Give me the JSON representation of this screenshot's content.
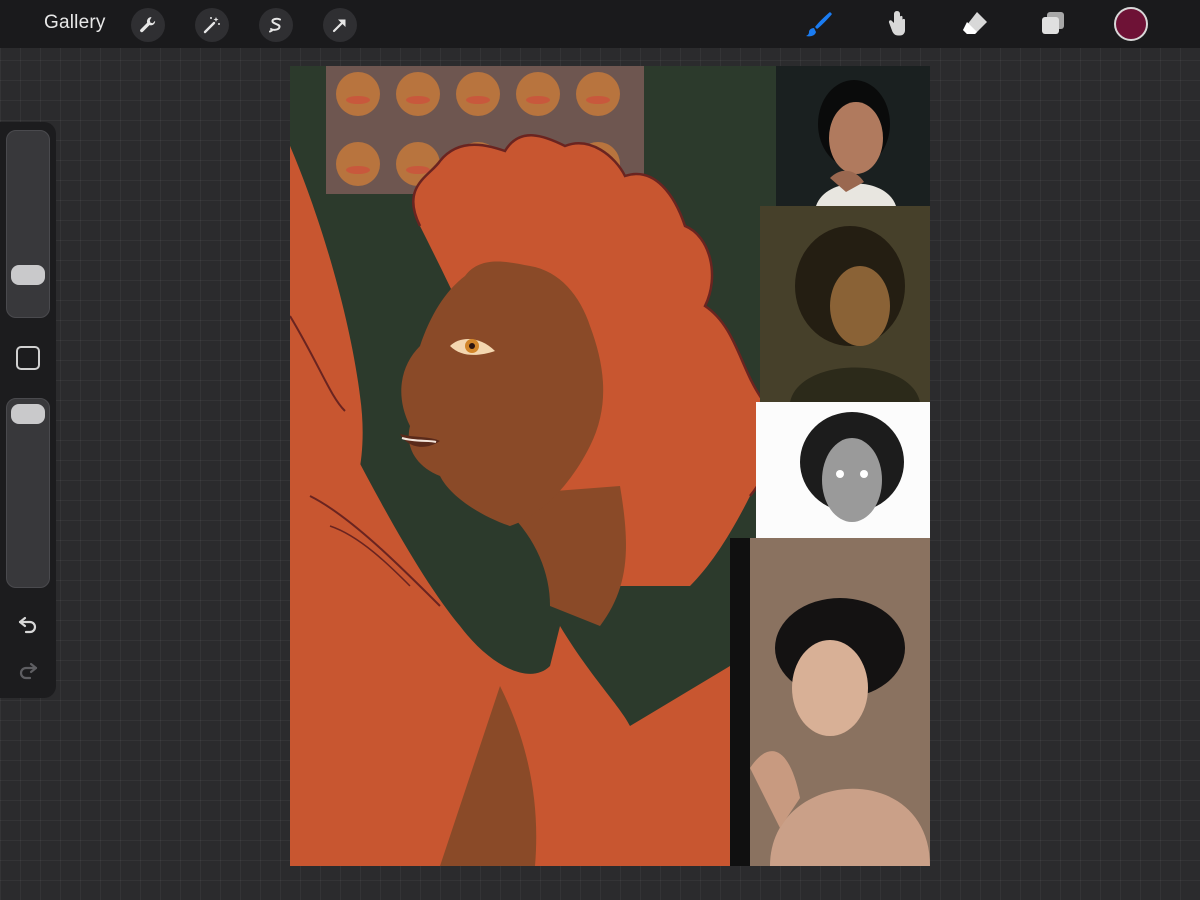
{
  "toolbar": {
    "gallery_label": "Gallery",
    "left_tools": [
      "wrench-icon",
      "magic-wand-icon",
      "selection-icon",
      "transform-arrow-icon"
    ],
    "right_tools": [
      "brush-icon",
      "smudge-icon",
      "eraser-icon",
      "layers-icon"
    ],
    "active_tool": "brush-icon",
    "active_color": "#6e1236",
    "brush_color": "#1a7cf2"
  },
  "sidebar": {
    "brush_size_level": 0.18,
    "opacity_level": 0.97
  },
  "canvas": {
    "background": "#2c3a2c",
    "skin": "#8a4a28",
    "fill": "#c85630",
    "lineart": "#6a2420",
    "emoji_strip_bg": "#6e5650"
  }
}
